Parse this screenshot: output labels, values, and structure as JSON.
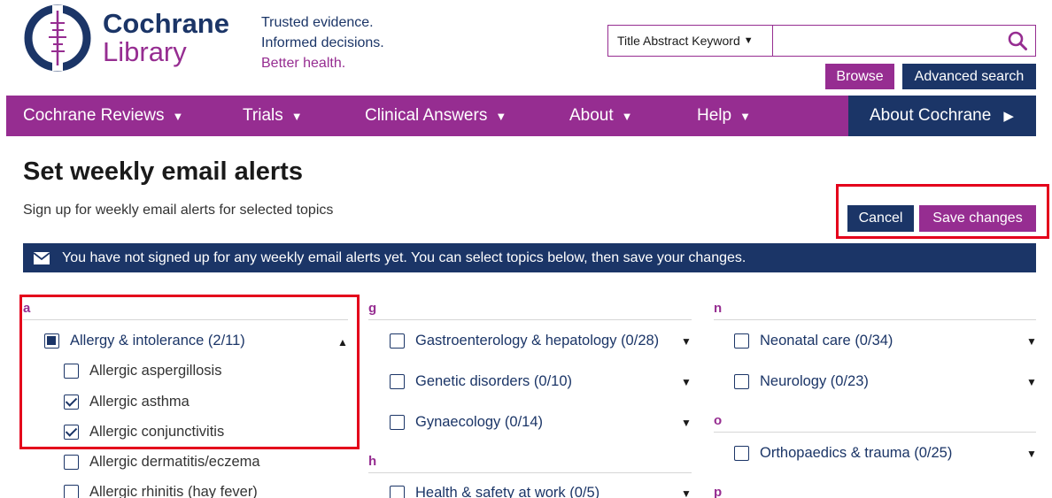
{
  "header": {
    "logo_line1": "Cochrane",
    "logo_line2": "Library",
    "tagline": [
      "Trusted evidence.",
      "Informed decisions.",
      "Better health."
    ],
    "search_select": "Title Abstract Keyword",
    "search_placeholder": "",
    "browse": "Browse",
    "advanced_search": "Advanced search"
  },
  "nav": {
    "items": [
      "Cochrane Reviews",
      "Trials",
      "Clinical Answers",
      "About",
      "Help"
    ],
    "about_cochrane": "About Cochrane"
  },
  "main": {
    "title": "Set weekly email alerts",
    "subtitle": "Sign up for weekly email alerts for selected topics",
    "cancel": "Cancel",
    "save": "Save changes",
    "notice": "You have not signed up for any weekly email alerts yet. You can select topics below, then save your changes."
  },
  "columns": {
    "a": {
      "letter": "a",
      "parent": "Allergy & intolerance (2/11)",
      "children": [
        "Allergic aspergillosis",
        "Allergic asthma",
        "Allergic conjunctivitis",
        "Allergic dermatitis/eczema",
        "Allergic rhinitis (hay fever)"
      ]
    },
    "g": {
      "letter": "g",
      "items": [
        "Gastroenterology & hepatology (0/28)",
        "Genetic disorders (0/10)",
        "Gynaecology (0/14)"
      ]
    },
    "h": {
      "letter": "h",
      "items": [
        "Health & safety at work (0/5)"
      ]
    },
    "n": {
      "letter": "n",
      "items": [
        "Neonatal care (0/34)",
        "Neurology (0/23)"
      ]
    },
    "o": {
      "letter": "o",
      "items": [
        "Orthopaedics & trauma (0/25)"
      ]
    },
    "p": {
      "letter": "p"
    }
  },
  "colors": {
    "purple": "#962d91",
    "navy": "#1b3567",
    "highlight_red": "#e4001b"
  }
}
